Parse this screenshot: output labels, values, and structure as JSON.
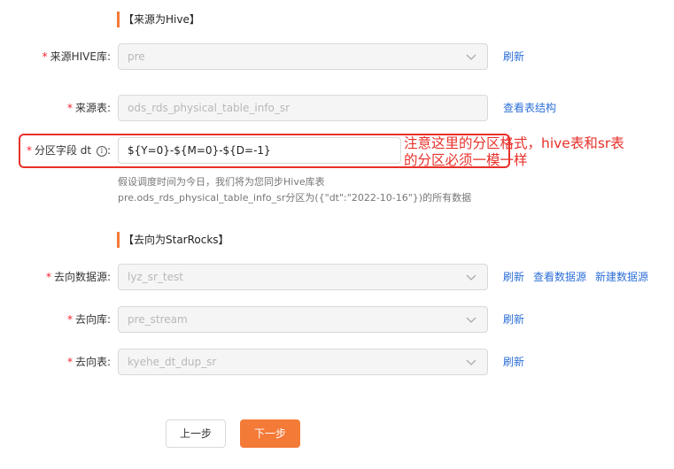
{
  "source_section": {
    "title": "【来源为Hive】",
    "hive_db": {
      "label": "来源HIVE库:",
      "value": "pre",
      "action": "刷新"
    },
    "table": {
      "label": "来源表:",
      "value": "ods_rds_physical_table_info_sr",
      "action": "查看表结构"
    },
    "partition": {
      "label": "分区字段 dt",
      "colon": ":",
      "value": "${Y=0}-${M=0}-${D=-1}",
      "hint_line1": "假设调度时间为今日，我们将为您同步Hive库表",
      "hint_line2": "pre.ods_rds_physical_table_info_sr分区为({\"dt\":\"2022-10-16\"})的所有数据"
    }
  },
  "annotation": {
    "line1": "注意这里的分区格式，hive表和sr表",
    "line2": "的分区必须一模一样",
    "color": "#e8302a"
  },
  "target_section": {
    "title": "【去向为StarRocks】",
    "datasource": {
      "label": "去向数据源:",
      "value": "lyz_sr_test",
      "actions": [
        "刷新",
        "查看数据源",
        "新建数据源"
      ]
    },
    "db": {
      "label": "去向库:",
      "value": "pre_stream",
      "action": "刷新"
    },
    "table": {
      "label": "去向表:",
      "value": "kyehe_dt_dup_sr",
      "action": "刷新"
    }
  },
  "buttons": {
    "prev": "上一步",
    "next": "下一步"
  },
  "required_mark": "*",
  "colors": {
    "accent": "#f47a38",
    "link": "#2d6fd8",
    "required": "#f5222d"
  }
}
